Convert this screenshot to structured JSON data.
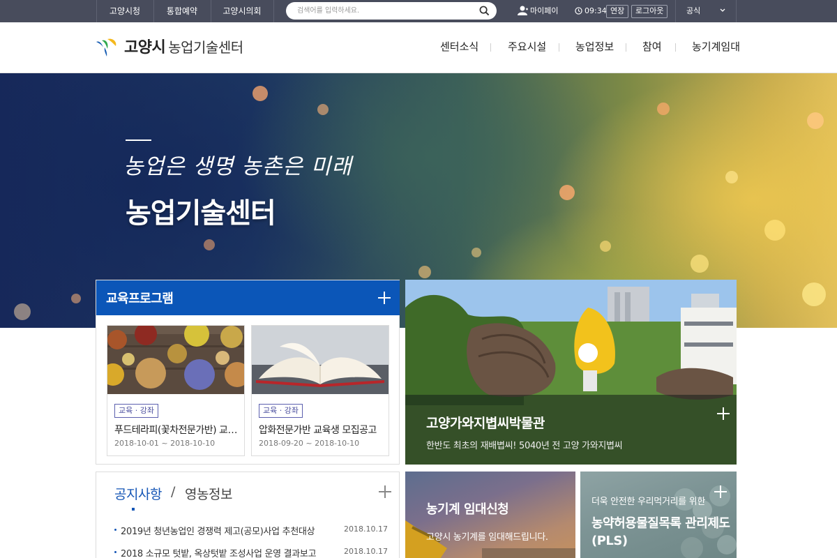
{
  "topbar": {
    "links": [
      "고양시청",
      "통합예약",
      "고양시의회"
    ],
    "search_placeholder": "검색어를 입력하세요.",
    "mypage": "마이페이지",
    "time": "09:34",
    "extend": "연장",
    "logout": "로그아웃",
    "sns": "공식SNS"
  },
  "header": {
    "logo_city": "고양시",
    "logo_center": "농업기술센터",
    "nav": [
      "센터소식",
      "주요시설",
      "농업정보",
      "참여",
      "농기계임대"
    ]
  },
  "hero": {
    "subtitle": "농업은 생명 농촌은 미래",
    "title": "농업기술센터"
  },
  "education": {
    "title": "교육프로그램",
    "cards": [
      {
        "badge": "교육 · 강좌",
        "title": "푸드테라피(꽃차전문가반) 교육생 모집공고",
        "date": "2018-10-01 ~ 2018-10-10"
      },
      {
        "badge": "교육 · 강좌",
        "title": "압화전문가반 교육생 모집공고",
        "date": "2018-09-20 ~ 2018-10-10"
      }
    ]
  },
  "museum": {
    "title": "고양가와지볍씨박물관",
    "desc": "한반도 최초의 재배볍씨! 5040년 전 고양 가와지볍씨"
  },
  "notice": {
    "tab_active": "공지사항",
    "tab_inactive": "영농정보",
    "items": [
      {
        "text": "2019년 청년농업인 경쟁력 제고(공모)사업 추천대상",
        "date": "2018.10.17"
      },
      {
        "text": "2018 소규모 텃밭, 옥상텃밭 조성사업 운영 결과보고",
        "date": "2018.10.17"
      }
    ]
  },
  "rental": {
    "title": "농기계 임대신청",
    "desc": "고양시 농기계를 임대해드립니다."
  },
  "pls": {
    "subtitle": "더욱 안전한 우리먹거리를 위한",
    "title": "농약허용물질목록 관리제도(PLS)"
  },
  "colors": {
    "topbar": "#484c5c",
    "primary_blue": "#0b56b8",
    "notice_blue": "#1556b6"
  }
}
